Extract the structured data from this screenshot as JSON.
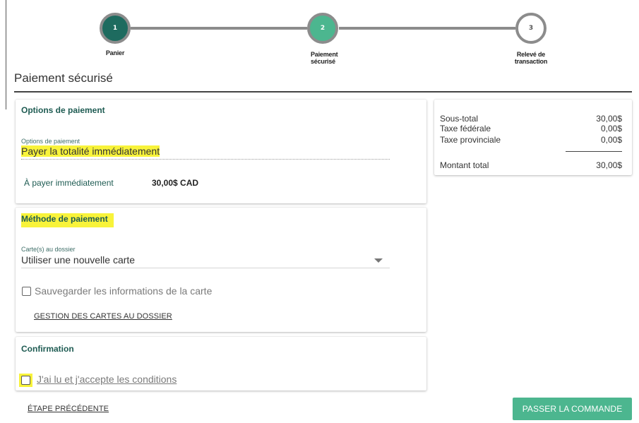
{
  "stepper": {
    "steps": [
      {
        "number": "1",
        "label": "Panier",
        "status": "done"
      },
      {
        "number": "2",
        "label": "Paiement sécurisé",
        "status": "active"
      },
      {
        "number": "3",
        "label": "Relevé de transaction",
        "status": "todo"
      }
    ]
  },
  "page": {
    "title": "Paiement sécurisé"
  },
  "payment_options": {
    "title": "Options de paiement",
    "field_label": "Options de paiement",
    "field_value": "Payer la totalité immédiatement",
    "due_label": "À payer immédiatement",
    "due_value": "30,00$ CAD"
  },
  "payment_method": {
    "title": "Méthode de paiement",
    "cards_label": "Carte(s) au dossier",
    "cards_value": "Utiliser une nouvelle carte",
    "save_card_label": "Sauvegarder les informations de la carte",
    "save_card_checked": false,
    "manage_cards_link": "GESTION DES CARTES AU DOSSIER"
  },
  "confirmation": {
    "title": "Confirmation",
    "accept_label": "J'ai lu et j'accepte les conditions",
    "accept_checked": false
  },
  "summary": {
    "subtotal_label": "Sous-total",
    "subtotal_value": "30,00$",
    "federal_tax_label": "Taxe fédérale",
    "federal_tax_value": "0,00$",
    "provincial_tax_label": "Taxe provinciale",
    "provincial_tax_value": "0,00$",
    "total_label": "Montant total",
    "total_value": "30,00$"
  },
  "footer": {
    "previous_step_link": "ÉTAPE PRÉCÉDENTE",
    "place_order_button": "PASSER LA COMMANDE"
  },
  "colors": {
    "step_done": "#1e6b5f",
    "step_active": "#4cb68f",
    "highlight": "#f8f33a",
    "card_title": "#1e5b52",
    "primary_button": "#4cb68f"
  }
}
